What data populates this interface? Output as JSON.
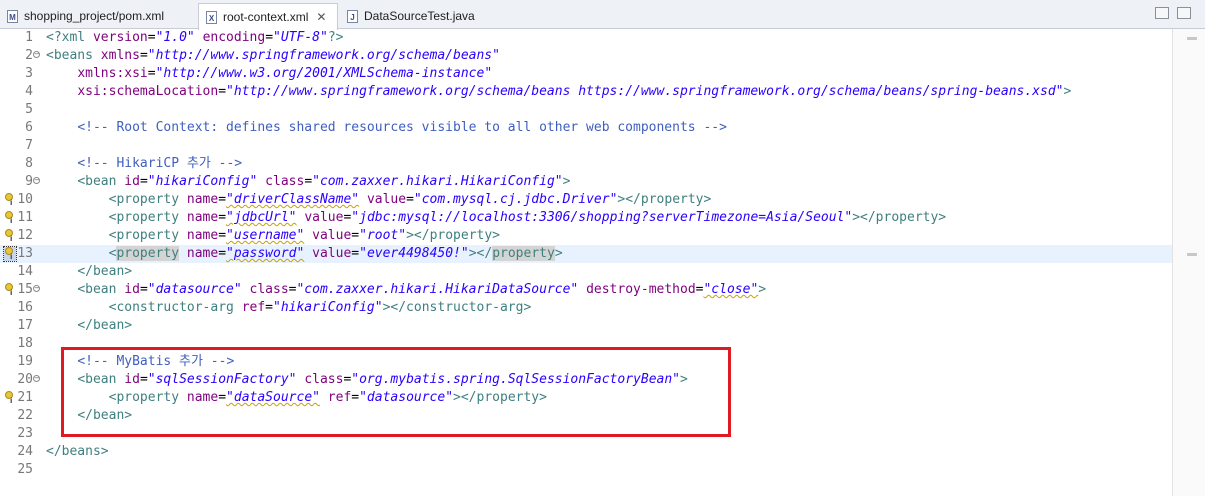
{
  "tabs": [
    {
      "label": "shopping_project/pom.xml",
      "icon": "maven-pom-icon",
      "icon_glyph": "M",
      "active": false
    },
    {
      "label": "root-context.xml",
      "icon": "xml-file-icon",
      "icon_glyph": "X",
      "active": true
    },
    {
      "label": "DataSourceTest.java",
      "icon": "java-file-icon",
      "icon_glyph": "J",
      "active": false
    }
  ],
  "close_glyph": "✕",
  "fold_glyph": "−",
  "colors": {
    "tag": "#3f7f7f",
    "attribute": "#7f007f",
    "value": "#2a00ff",
    "comment": "#3f5fbf",
    "current_line": "#e8f2fe",
    "highlight_box": "#e01a22"
  },
  "highlight_box_label": "MyBatis section highlight",
  "lines": [
    {
      "n": "1",
      "tokens": [
        [
          "tag",
          "<?xml "
        ],
        [
          "attr",
          "version"
        ],
        [
          "plain",
          "="
        ],
        [
          "val",
          "\"1.0\""
        ],
        [
          "plain",
          " "
        ],
        [
          "attr",
          "encoding"
        ],
        [
          "plain",
          "="
        ],
        [
          "val",
          "\"UTF-8\""
        ],
        [
          "tag",
          "?>"
        ]
      ]
    },
    {
      "n": "2",
      "fold": true,
      "tokens": [
        [
          "tag",
          "<beans "
        ],
        [
          "attr",
          "xmlns"
        ],
        [
          "plain",
          "="
        ],
        [
          "val",
          "\"http://www.springframework.org/schema/beans\""
        ]
      ]
    },
    {
      "n": "3",
      "tokens": [
        [
          "plain",
          "    "
        ],
        [
          "attr",
          "xmlns:xsi"
        ],
        [
          "plain",
          "="
        ],
        [
          "val",
          "\"http://www.w3.org/2001/XMLSchema-instance\""
        ]
      ]
    },
    {
      "n": "4",
      "tokens": [
        [
          "plain",
          "    "
        ],
        [
          "attr",
          "xsi:schemaLocation"
        ],
        [
          "plain",
          "="
        ],
        [
          "val",
          "\"http://www.springframework.org/schema/beans https://www.springframework.org/schema/beans/spring-beans.xsd\""
        ],
        [
          "tag",
          ">"
        ]
      ]
    },
    {
      "n": "5",
      "tokens": []
    },
    {
      "n": "6",
      "tokens": [
        [
          "plain",
          "    "
        ],
        [
          "cmt",
          "<!-- Root Context: defines shared resources visible to all other web components -->"
        ]
      ]
    },
    {
      "n": "7",
      "tokens": []
    },
    {
      "n": "8",
      "tokens": [
        [
          "plain",
          "    "
        ],
        [
          "cmt",
          "<!-- HikariCP 추가 -->"
        ]
      ]
    },
    {
      "n": "9",
      "fold": true,
      "tokens": [
        [
          "plain",
          "    "
        ],
        [
          "tag",
          "<bean "
        ],
        [
          "attr",
          "id"
        ],
        [
          "plain",
          "="
        ],
        [
          "val",
          "\"hikariConfig\""
        ],
        [
          "plain",
          " "
        ],
        [
          "attr",
          "class"
        ],
        [
          "plain",
          "="
        ],
        [
          "val",
          "\"com.zaxxer.hikari.HikariConfig\""
        ],
        [
          "tag",
          ">"
        ]
      ]
    },
    {
      "n": "10",
      "ann": true,
      "tokens": [
        [
          "plain",
          "        "
        ],
        [
          "tag",
          "<property "
        ],
        [
          "attr",
          "name"
        ],
        [
          "plain",
          "="
        ],
        [
          "valsq",
          "\"driverClassName\""
        ],
        [
          "plain",
          " "
        ],
        [
          "attr",
          "value"
        ],
        [
          "plain",
          "="
        ],
        [
          "val",
          "\"com.mysql.cj.jdbc.Driver\""
        ],
        [
          "tag",
          "></property>"
        ]
      ]
    },
    {
      "n": "11",
      "ann": true,
      "tokens": [
        [
          "plain",
          "        "
        ],
        [
          "tag",
          "<property "
        ],
        [
          "attr",
          "name"
        ],
        [
          "plain",
          "="
        ],
        [
          "valsq",
          "\"jdbcUrl\""
        ],
        [
          "plain",
          " "
        ],
        [
          "attr",
          "value"
        ],
        [
          "plain",
          "="
        ],
        [
          "val",
          "\"jdbc:mysql://localhost:3306/shopping?serverTimezone=Asia/Seoul\""
        ],
        [
          "tag",
          "></property>"
        ]
      ]
    },
    {
      "n": "12",
      "ann": true,
      "tokens": [
        [
          "plain",
          "        "
        ],
        [
          "tag",
          "<property "
        ],
        [
          "attr",
          "name"
        ],
        [
          "plain",
          "="
        ],
        [
          "valsq",
          "\"username\""
        ],
        [
          "plain",
          " "
        ],
        [
          "attr",
          "value"
        ],
        [
          "plain",
          "="
        ],
        [
          "val",
          "\"root\""
        ],
        [
          "tag",
          "></property>"
        ]
      ]
    },
    {
      "n": "13",
      "ann": true,
      "sel": true,
      "current": true,
      "tokens": [
        [
          "plain",
          "        "
        ],
        [
          "tag",
          "<"
        ],
        [
          "taghl",
          "property"
        ],
        [
          "tag",
          " "
        ],
        [
          "attr",
          "name"
        ],
        [
          "plain",
          "="
        ],
        [
          "valsq",
          "\"password\""
        ],
        [
          "plain",
          " "
        ],
        [
          "attr",
          "value"
        ],
        [
          "plain",
          "="
        ],
        [
          "val",
          "\"ever4498450!\""
        ],
        [
          "tag",
          "></"
        ],
        [
          "taghl",
          "property"
        ],
        [
          "tag",
          ">"
        ]
      ]
    },
    {
      "n": "14",
      "tokens": [
        [
          "plain",
          "    "
        ],
        [
          "tag",
          "</bean>"
        ]
      ]
    },
    {
      "n": "15",
      "ann": true,
      "fold": true,
      "tokens": [
        [
          "plain",
          "    "
        ],
        [
          "tag",
          "<bean "
        ],
        [
          "attr",
          "id"
        ],
        [
          "plain",
          "="
        ],
        [
          "val",
          "\"datasource\""
        ],
        [
          "plain",
          " "
        ],
        [
          "attr",
          "class"
        ],
        [
          "plain",
          "="
        ],
        [
          "val",
          "\"com.zaxxer.hikari.HikariDataSource\""
        ],
        [
          "plain",
          " "
        ],
        [
          "attr",
          "destroy-method"
        ],
        [
          "plain",
          "="
        ],
        [
          "valsq",
          "\"close\""
        ],
        [
          "tag",
          ">"
        ]
      ]
    },
    {
      "n": "16",
      "tokens": [
        [
          "plain",
          "        "
        ],
        [
          "tag",
          "<constructor-arg "
        ],
        [
          "attr",
          "ref"
        ],
        [
          "plain",
          "="
        ],
        [
          "val",
          "\"hikariConfig\""
        ],
        [
          "tag",
          "></constructor-arg>"
        ]
      ]
    },
    {
      "n": "17",
      "tokens": [
        [
          "plain",
          "    "
        ],
        [
          "tag",
          "</bean>"
        ]
      ]
    },
    {
      "n": "18",
      "tokens": []
    },
    {
      "n": "19",
      "tokens": [
        [
          "plain",
          "    "
        ],
        [
          "cmt",
          "<!-- MyBatis 추가 -->"
        ]
      ]
    },
    {
      "n": "20",
      "fold": true,
      "tokens": [
        [
          "plain",
          "    "
        ],
        [
          "tag",
          "<bean "
        ],
        [
          "attr",
          "id"
        ],
        [
          "plain",
          "="
        ],
        [
          "val",
          "\"sqlSessionFactory\""
        ],
        [
          "plain",
          " "
        ],
        [
          "attr",
          "class"
        ],
        [
          "plain",
          "="
        ],
        [
          "val",
          "\"org.mybatis.spring.SqlSessionFactoryBean\""
        ],
        [
          "tag",
          ">"
        ]
      ]
    },
    {
      "n": "21",
      "ann": true,
      "tokens": [
        [
          "plain",
          "        "
        ],
        [
          "tag",
          "<property "
        ],
        [
          "attr",
          "name"
        ],
        [
          "plain",
          "="
        ],
        [
          "valsq",
          "\"dataSource\""
        ],
        [
          "plain",
          " "
        ],
        [
          "attr",
          "ref"
        ],
        [
          "plain",
          "="
        ],
        [
          "val",
          "\"datasource\""
        ],
        [
          "tag",
          "></property>"
        ]
      ]
    },
    {
      "n": "22",
      "tokens": [
        [
          "plain",
          "    "
        ],
        [
          "tag",
          "</bean>"
        ]
      ]
    },
    {
      "n": "23",
      "tokens": []
    },
    {
      "n": "24",
      "tokens": [
        [
          "tag",
          "</beans>"
        ]
      ]
    },
    {
      "n": "25",
      "tokens": []
    }
  ]
}
